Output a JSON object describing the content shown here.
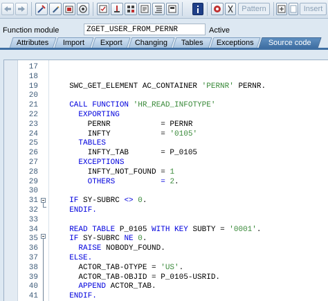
{
  "toolbar": {
    "pattern_label": "Pattern",
    "insert_label": "Insert"
  },
  "function_module": {
    "label": "Function module",
    "value": "ZGET_USER_FROM_PERNR",
    "status": "Active"
  },
  "tabs": [
    {
      "label": "Attributes"
    },
    {
      "label": "Import"
    },
    {
      "label": "Export"
    },
    {
      "label": "Changing"
    },
    {
      "label": "Tables"
    },
    {
      "label": "Exceptions"
    },
    {
      "label": "Source code"
    }
  ],
  "active_tab": "Source code",
  "editor": {
    "lines": [
      {
        "no": "17",
        "segs": []
      },
      {
        "no": "18",
        "segs": []
      },
      {
        "no": "19",
        "segs": [
          {
            "t": "  SWC_GET_ELEMENT AC_CONTAINER ",
            "c": "p"
          },
          {
            "t": "'PERNR'",
            "c": "s"
          },
          {
            "t": " PERNR.",
            "c": "p"
          }
        ]
      },
      {
        "no": "20",
        "segs": []
      },
      {
        "no": "21",
        "segs": [
          {
            "t": "  CALL FUNCTION ",
            "c": "k"
          },
          {
            "t": "'HR_READ_INFOTYPE'",
            "c": "s"
          }
        ]
      },
      {
        "no": "22",
        "segs": [
          {
            "t": "    EXPORTING",
            "c": "k"
          }
        ]
      },
      {
        "no": "23",
        "segs": [
          {
            "t": "      PERNR           = PERNR",
            "c": "p"
          }
        ]
      },
      {
        "no": "24",
        "segs": [
          {
            "t": "      INFTY           = ",
            "c": "p"
          },
          {
            "t": "'0105'",
            "c": "s"
          }
        ]
      },
      {
        "no": "25",
        "segs": [
          {
            "t": "    TABLES",
            "c": "k"
          }
        ]
      },
      {
        "no": "26",
        "segs": [
          {
            "t": "      INFTY_TAB       = P_0105",
            "c": "p"
          }
        ]
      },
      {
        "no": "27",
        "segs": [
          {
            "t": "    EXCEPTIONS",
            "c": "k"
          }
        ]
      },
      {
        "no": "28",
        "segs": [
          {
            "t": "      INFTY_NOT_FOUND = ",
            "c": "p"
          },
          {
            "t": "1",
            "c": "n"
          }
        ]
      },
      {
        "no": "29",
        "segs": [
          {
            "t": "      OTHERS          = ",
            "c": "k"
          },
          {
            "t": "2",
            "c": "n"
          },
          {
            "t": ".",
            "c": "p"
          }
        ]
      },
      {
        "no": "30",
        "segs": []
      },
      {
        "no": "31",
        "segs": [
          {
            "t": "  IF ",
            "c": "k"
          },
          {
            "t": "SY-SUBRC ",
            "c": "p"
          },
          {
            "t": "<>",
            "c": "k"
          },
          {
            "t": " ",
            "c": "p"
          },
          {
            "t": "0",
            "c": "n"
          },
          {
            "t": ".",
            "c": "p"
          }
        ]
      },
      {
        "no": "32",
        "segs": [
          {
            "t": "  ENDIF.",
            "c": "k"
          }
        ]
      },
      {
        "no": "33",
        "segs": []
      },
      {
        "no": "34",
        "segs": [
          {
            "t": "  READ TABLE ",
            "c": "k"
          },
          {
            "t": "P_0105 ",
            "c": "p"
          },
          {
            "t": "WITH KEY ",
            "c": "k"
          },
          {
            "t": "SUBTY = ",
            "c": "p"
          },
          {
            "t": "'0001'",
            "c": "s"
          },
          {
            "t": ".",
            "c": "p"
          }
        ]
      },
      {
        "no": "35",
        "segs": [
          {
            "t": "  IF ",
            "c": "k"
          },
          {
            "t": "SY-SUBRC ",
            "c": "p"
          },
          {
            "t": "NE",
            "c": "k"
          },
          {
            "t": " ",
            "c": "p"
          },
          {
            "t": "0",
            "c": "n"
          },
          {
            "t": ".",
            "c": "p"
          }
        ]
      },
      {
        "no": "36",
        "segs": [
          {
            "t": "    RAISE ",
            "c": "k"
          },
          {
            "t": "NOBODY_FOUND.",
            "c": "p"
          }
        ]
      },
      {
        "no": "37",
        "segs": [
          {
            "t": "  ELSE.",
            "c": "k"
          }
        ]
      },
      {
        "no": "38",
        "segs": [
          {
            "t": "    ACTOR_TAB-OTYPE = ",
            "c": "p"
          },
          {
            "t": "'US'",
            "c": "s"
          },
          {
            "t": ".",
            "c": "p"
          }
        ]
      },
      {
        "no": "39",
        "segs": [
          {
            "t": "    ACTOR_TAB-OBJID = P_0105-USRID.",
            "c": "p"
          }
        ]
      },
      {
        "no": "40",
        "segs": [
          {
            "t": "    APPEND ",
            "c": "k"
          },
          {
            "t": "ACTOR_TAB.",
            "c": "p"
          }
        ]
      },
      {
        "no": "41",
        "segs": [
          {
            "t": "  ENDIF.",
            "c": "k"
          }
        ]
      }
    ]
  },
  "colors": {
    "keyword": "#0000dd",
    "literal": "#3a8a3a",
    "active_tab": "#3f6fa3"
  },
  "icons": [
    "back-arrow-icon",
    "forward-arrow-icon",
    "other-object-icon",
    "display-change-icon",
    "activate-icon",
    "check-icon",
    "test-icon",
    "where-used-icon",
    "object-list-icon",
    "navigation-window-icon",
    "pretty-printer-icon",
    "info-icon",
    "rectangle-icon",
    "help-icon",
    "cut-icon",
    "insert-icon"
  ]
}
